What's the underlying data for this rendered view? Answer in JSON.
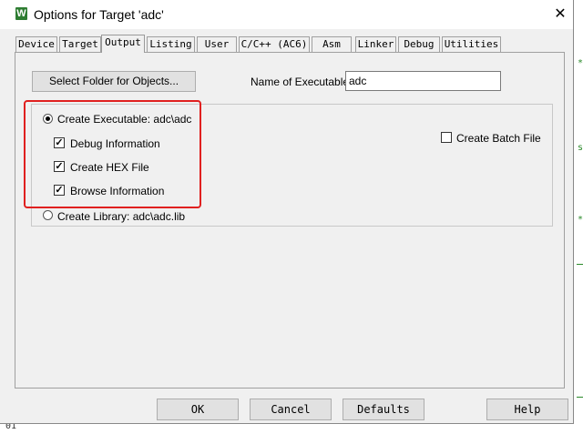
{
  "window": {
    "title": "Options for Target 'adc'",
    "app_icon_glyph": "W",
    "close_glyph": "✕"
  },
  "tabs": [
    {
      "label": "Device",
      "active": false
    },
    {
      "label": "Target",
      "active": false
    },
    {
      "label": "Output",
      "active": true
    },
    {
      "label": "Listing",
      "active": false
    },
    {
      "label": "User",
      "active": false
    },
    {
      "label": "C/C++ (AC6)",
      "active": false
    },
    {
      "label": "Asm",
      "active": false
    },
    {
      "label": "Linker",
      "active": false
    },
    {
      "label": "Debug",
      "active": false
    },
    {
      "label": "Utilities",
      "active": false
    }
  ],
  "output": {
    "select_folder_label": "Select Folder for Objects...",
    "name_of_executable_label": "Name of Executable:",
    "name_of_executable_value": "adc",
    "create_executable_label": "Create Executable:  adc\\adc",
    "create_executable_selected": true,
    "debug_information_label": "Debug Information",
    "debug_information_checked": true,
    "create_hex_label": "Create HEX File",
    "create_hex_checked": true,
    "browse_information_label": "Browse Information",
    "browse_information_checked": true,
    "create_library_label": "Create Library:  adc\\adc.lib",
    "create_library_selected": false,
    "create_batch_label": "Create Batch File",
    "create_batch_checked": false
  },
  "buttons": {
    "ok": "OK",
    "cancel": "Cancel",
    "defaults": "Defaults",
    "help": "Help"
  },
  "background": {
    "editor_marks": [
      "*",
      "s",
      "*"
    ],
    "bottom_text": "01"
  },
  "colors": {
    "highlight_border": "#e0201f",
    "app_icon": "#2e7d32"
  }
}
